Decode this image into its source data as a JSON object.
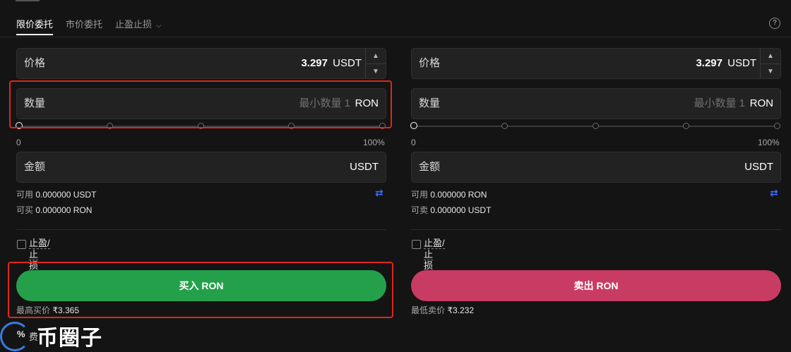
{
  "tabs": [
    {
      "label": "限价委托",
      "active": true
    },
    {
      "label": "市价委托",
      "active": false
    },
    {
      "label": "止盈止损",
      "active": false
    }
  ],
  "tab_dropdown_icon": "chevron-down-icon",
  "help_icon": "question-circle-icon",
  "help_glyph": "?",
  "buy": {
    "price_label": "价格",
    "price_value": "3.297",
    "price_unit": "USDT",
    "qty_label": "数量",
    "qty_placeholder": "最小数量 1",
    "qty_unit": "RON",
    "slider_min": "0",
    "slider_max": "100%",
    "slider_value": 0,
    "amount_label": "金额",
    "amount_unit": "USDT",
    "avail_label": "可用",
    "avail_value": "0.000000 USDT",
    "can_label": "可买",
    "can_value": "0.000000 RON",
    "swap_icon": "swap-arrows-icon",
    "swap_glyph": "⇄",
    "tpsl_label_1": "止盈/止",
    "tpsl_label_2": "损",
    "button_label": "买入 RON",
    "hint_label": "最高买价",
    "hint_value": "₹3.365"
  },
  "sell": {
    "price_label": "价格",
    "price_value": "3.297",
    "price_unit": "USDT",
    "qty_label": "数量",
    "qty_placeholder": "最小数量 1",
    "qty_unit": "RON",
    "slider_min": "0",
    "slider_max": "100%",
    "slider_value": 0,
    "amount_label": "金额",
    "amount_unit": "USDT",
    "avail_label": "可用",
    "avail_value": "0.000000 RON",
    "can_label": "可卖",
    "can_value": "0.000000 USDT",
    "swap_icon": "swap-arrows-icon",
    "swap_glyph": "⇄",
    "tpsl_label_1": "止盈/止",
    "tpsl_label_2": "损",
    "button_label": "卖出 RON",
    "hint_label": "最低卖价",
    "hint_value": "₹3.232"
  },
  "stepper": {
    "up": "▲",
    "down": "▼"
  },
  "colors": {
    "buy_button": "#24a04b",
    "sell_button": "#c83c64",
    "highlight_box": "#e0261b",
    "swap_icon": "#3b6bff"
  },
  "watermark": {
    "text": "币圈子",
    "pct": "%",
    "fee": "费"
  }
}
